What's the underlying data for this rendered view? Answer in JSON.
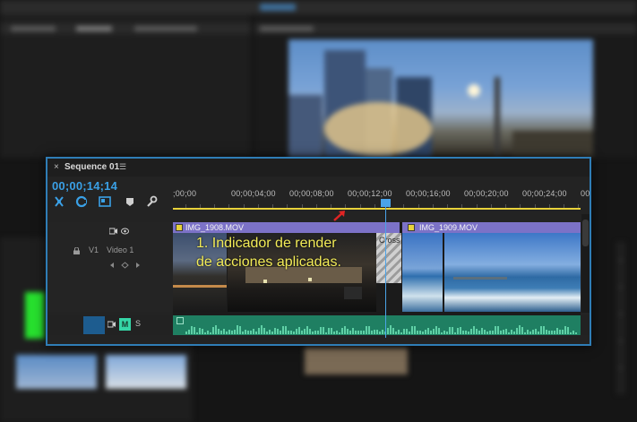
{
  "app": {
    "background_accent": "#2f7db6",
    "render_bar_color": "#e8d23a"
  },
  "sequence_panel": {
    "close_icon": "×",
    "title": "Sequence 01",
    "menu_icon": "☰",
    "timecode": "00;00;14;14",
    "tools": [
      "snap-icon",
      "linked-selection-icon",
      "insert-sequence-icon",
      "marker-icon",
      "wrench-icon"
    ]
  },
  "ruler": {
    "ticks": [
      ";00;00",
      "00;00;04;00",
      "00;00;08;00",
      "00;00;12;00",
      "00;00;16;00",
      "00;00;20;00",
      "00;00;24;00",
      "00;0"
    ]
  },
  "tracks": {
    "v1": {
      "target": "V1",
      "name": "Video 1"
    },
    "clips": [
      {
        "name": "IMG_1908.MOV",
        "color": "#7c72c7"
      },
      {
        "name": "IMG_1909.MOV",
        "color": "#7c72c7"
      }
    ],
    "transition_label": "Cross",
    "audio": {
      "mute_label": "M",
      "solo_label": "S",
      "clip_color": "#1f7f62"
    }
  },
  "annotation": {
    "line1": "1. Indicador de render",
    "line2": "de acciones aplicadas."
  }
}
